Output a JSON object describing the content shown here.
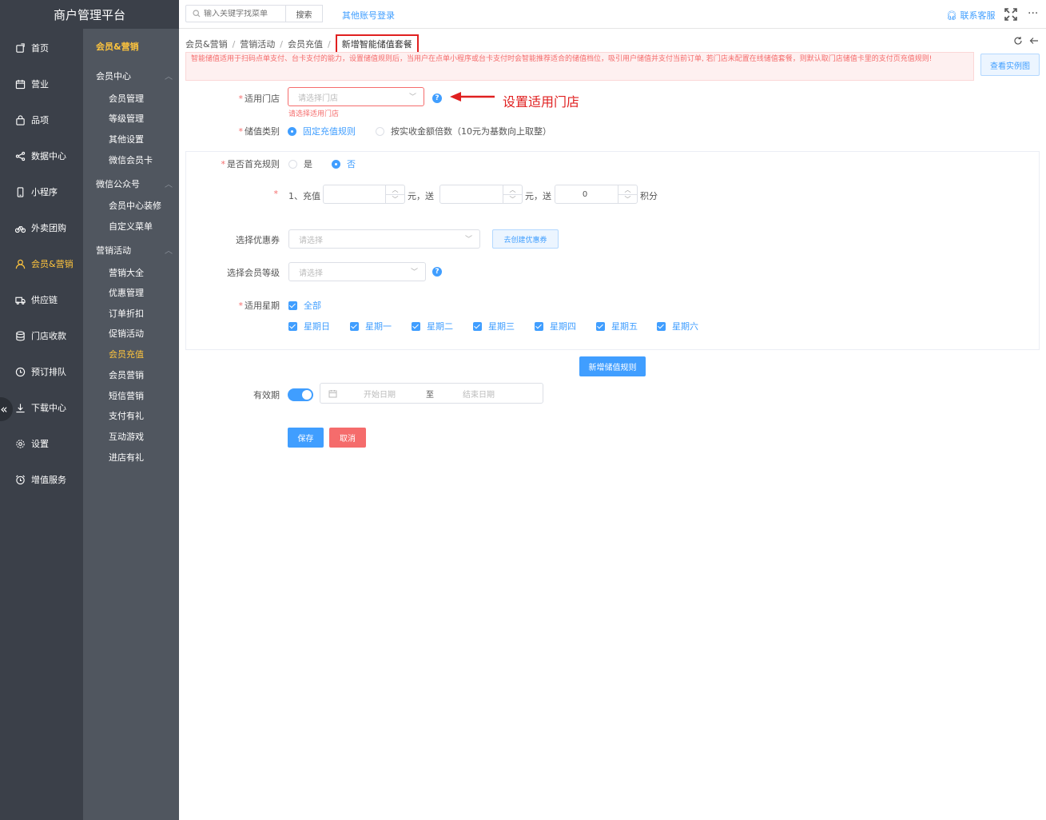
{
  "app": {
    "title": "商户管理平台"
  },
  "primary_nav": [
    {
      "label": "首页",
      "icon": "home-icon"
    },
    {
      "label": "营业",
      "icon": "calendar-icon"
    },
    {
      "label": "品项",
      "icon": "bag-icon"
    },
    {
      "label": "数据中心",
      "icon": "share-icon"
    },
    {
      "label": "小程序",
      "icon": "phone-icon"
    },
    {
      "label": "外卖团购",
      "icon": "bike-icon"
    },
    {
      "label": "会员&营销",
      "icon": "user-icon"
    },
    {
      "label": "供应链",
      "icon": "truck-icon"
    },
    {
      "label": "门店收款",
      "icon": "database-icon"
    },
    {
      "label": "预订排队",
      "icon": "clock-icon"
    },
    {
      "label": "下载中心",
      "icon": "download-icon"
    },
    {
      "label": "设置",
      "icon": "gear-icon"
    },
    {
      "label": "增值服务",
      "icon": "alarm-icon"
    }
  ],
  "secondary_nav": {
    "header": "会员&营销",
    "groups": [
      {
        "label": "会员中心",
        "items": [
          "会员管理",
          "等级管理",
          "其他设置",
          "微信会员卡"
        ]
      },
      {
        "label": "微信公众号",
        "items": [
          "会员中心装修",
          "自定义菜单"
        ]
      },
      {
        "label": "营销活动",
        "items": [
          "营销大全",
          "优惠管理",
          "订单折扣",
          "促销活动",
          "会员充值",
          "会员营销",
          "短信营销",
          "支付有礼",
          "互动游戏",
          "进店有礼"
        ]
      }
    ],
    "collapse_glyph": "«"
  },
  "topbar": {
    "search_placeholder": "输入关键字找菜单",
    "search_button": "搜索",
    "other_login": "其他账号登录",
    "contact": "联系客服",
    "more": "···"
  },
  "breadcrumb": {
    "items": [
      "会员&营销",
      "营销活动",
      "会员充值"
    ],
    "separator": "/",
    "current": "新增智能储值套餐"
  },
  "notice": {
    "text": "智能储值适用于扫码点单支付、台卡支付的能力，设置储值规则后，当用户在点单小程序或台卡支付时会智能推荐适合的储值档位，吸引用户储值并支付当前订单, 若门店未配置在线储值套餐，则默认取门店储值卡里的支付页充值规则!",
    "example_button": "查看实例图"
  },
  "form": {
    "store": {
      "label": "适用门店",
      "placeholder": "请选择门店",
      "error": "请选择适用门店",
      "annotation": "设置适用门店"
    },
    "type": {
      "label": "储值类别",
      "options": [
        "固定充值规则",
        "按实收金额倍数（10元为基数向上取整）"
      ],
      "selected": "固定充值规则"
    },
    "first": {
      "label": "是否首充规则",
      "options": [
        "是",
        "否"
      ],
      "selected": "否"
    },
    "rule": {
      "prefix": "1、充值",
      "unit1": "元，送",
      "unit2": "元，送",
      "points_value": "0",
      "points_unit": "积分"
    },
    "coupon": {
      "label": "选择优惠券",
      "placeholder": "请选择",
      "create_button": "去创建优惠券"
    },
    "level": {
      "label": "选择会员等级",
      "placeholder": "请选择"
    },
    "weekdays": {
      "label": "适用星期",
      "all": "全部",
      "days": [
        "星期日",
        "星期一",
        "星期二",
        "星期三",
        "星期四",
        "星期五",
        "星期六"
      ]
    },
    "add_rule_button": "新增储值规则",
    "validity": {
      "label": "有效期",
      "enabled": true,
      "start_placeholder": "开始日期",
      "separator": "至",
      "end_placeholder": "结束日期"
    },
    "save_button": "保存",
    "cancel_button": "取消",
    "help_glyph": "?",
    "required_mark": "*"
  },
  "colors": {
    "primary": "#409eff",
    "danger": "#f56c6c",
    "highlight": "#ffc53d",
    "sidebar": "#3b4049",
    "subnav": "#50565f",
    "annotation": "#e02020"
  }
}
